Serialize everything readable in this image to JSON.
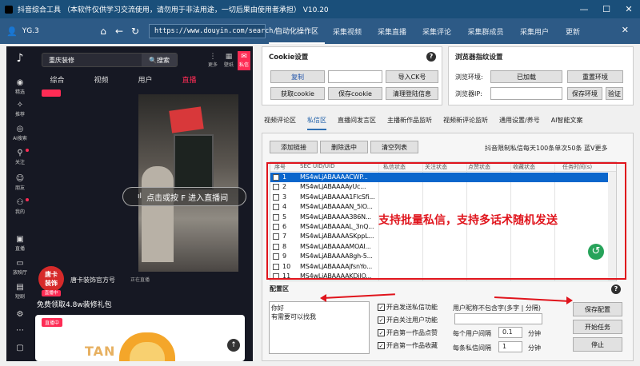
{
  "window": {
    "title": "抖音综合工具 （本软件仅供学习交流使用，请勿用于非法用途，一切后果由使用者承担）  V10.20"
  },
  "nav": {
    "user": "YG.3",
    "url": "https://www.douyin.com/search/",
    "tabs": [
      "自动化操作区",
      "采集视频",
      "采集直播",
      "采集评论",
      "采集群成员",
      "采集用户",
      "更新"
    ]
  },
  "phone": {
    "search_value": "重庆装修",
    "search_button": "搜索",
    "top_icons": [
      "更多",
      "壁纸",
      "私信"
    ],
    "tabs": [
      "综合",
      "视频",
      "用户",
      "直播"
    ],
    "sidebar": [
      "精选",
      "推荐",
      "AI搜索",
      "关注",
      "朋友",
      "我的",
      "直播",
      "放映厅",
      "短剧"
    ],
    "live_button": "点击或按 F 进入直播间",
    "avatar_text": "唐卡\n装饰",
    "live_badge": "直播中",
    "anchor_name": "唐卡装饰官方号",
    "anchor_status": "正在直播",
    "gift_text": "免费领取4.8w装修礼包",
    "card_badge": "直播中",
    "card_text": "TAN"
  },
  "cookie": {
    "title": "Cookie设置",
    "copy": "复制",
    "import": "导入CK号",
    "get": "获取cookie",
    "save": "保存cookie",
    "clear": "清理登陆信息"
  },
  "browser": {
    "title": "浏览器指纹设置",
    "env_label": "浏览环境:",
    "env_status": "已加载",
    "reset": "重置环境",
    "ip_label": "浏览器IP:",
    "save_env": "保存环境",
    "verify": "验证"
  },
  "subtabs": [
    "视频评论区",
    "私信区",
    "直播间发言区",
    "主播新作品监听",
    "视频新评论监听",
    "通用设置/养号",
    "AI智能文案"
  ],
  "list": {
    "add": "添加链接",
    "delete": "删除选中",
    "clear": "清空列表",
    "limit_note": "抖音限制私信每天100条单次50条 蓝V更多",
    "headers": [
      "序号",
      "SEC UID/UID",
      "私信状态",
      "关注状态",
      "点赞状态",
      "收藏状态",
      "任务时间(s)"
    ],
    "rows": [
      {
        "n": "1",
        "uid": "MS4wLjABAAAACWP..."
      },
      {
        "n": "2",
        "uid": "MS4wLjABAAAAyUc..."
      },
      {
        "n": "3",
        "uid": "MS4wLjABAAAA1FlcSfi..."
      },
      {
        "n": "4",
        "uid": "MS4wLjABAAAAN_5lO..."
      },
      {
        "n": "5",
        "uid": "MS4wLjABAAAA386N..."
      },
      {
        "n": "6",
        "uid": "MS4wLjABAAAAL_3nQ..."
      },
      {
        "n": "7",
        "uid": "MS4wLjABAAAASKppL..."
      },
      {
        "n": "8",
        "uid": "MS4wLjABAAAAMOAI..."
      },
      {
        "n": "9",
        "uid": "MS4wLjABAAAA8gh-5..."
      },
      {
        "n": "10",
        "uid": "MS4wLjABAAAAjfsnYo..."
      },
      {
        "n": "11",
        "uid": "MS4wLjABAAAAKDilO..."
      }
    ],
    "overlay": "支持批量私信，支持多话术随机发送"
  },
  "config": {
    "title": "配置区",
    "message": "你好\n有需要可以找我",
    "checks": [
      "开启发送私信功能",
      "开启关注用户功能",
      "开启第一作品点赞",
      "开启第一作品收藏"
    ],
    "nickname_label": "用户昵称不包含字(多字 | 分隔)",
    "interval_user_label": "每个用户间隔",
    "interval_user_value": "0.1",
    "interval_user_unit": "分钟",
    "interval_msg_label": "每条私信间隔",
    "interval_msg_value": "1",
    "interval_msg_unit": "分钟",
    "save": "保存配置",
    "start": "开始任务",
    "stop": "停止"
  }
}
